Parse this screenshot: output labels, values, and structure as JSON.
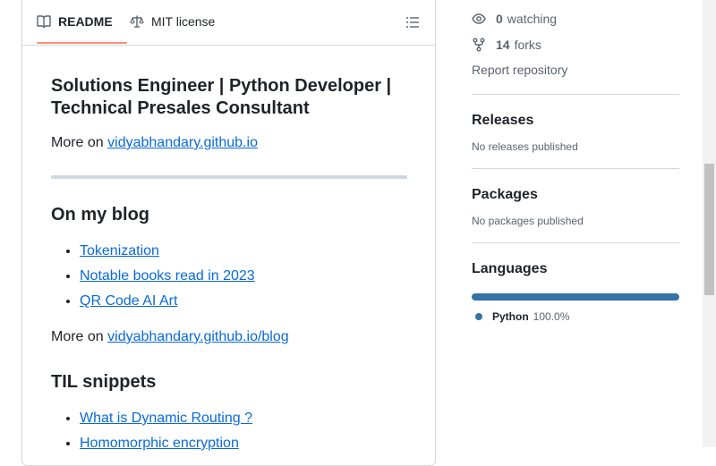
{
  "tabs": {
    "readme": "README",
    "license": "MIT license"
  },
  "readme": {
    "title": "Solutions Engineer | Python Developer | Technical Presales Consultant",
    "more_prefix": "More on ",
    "site_link": "vidyabhandary.github.io",
    "blog_heading": "On my blog",
    "blog_posts": [
      "Tokenization",
      "Notable books read in 2023",
      "QR Code AI Art"
    ],
    "blog_more_prefix": "More on ",
    "blog_link": "vidyabhandary.github.io/blog",
    "til_heading": "TIL snippets",
    "til_items": [
      "What is Dynamic Routing ?",
      "Homomorphic encryption"
    ]
  },
  "sidebar": {
    "watching_count": "0",
    "watching_label": "watching",
    "forks_count": "14",
    "forks_label": "forks",
    "report": "Report repository",
    "releases_heading": "Releases",
    "releases_sub": "No releases published",
    "packages_heading": "Packages",
    "packages_sub": "No packages published",
    "languages_heading": "Languages",
    "language_name": "Python",
    "language_pct": "100.0%",
    "language_fraction": 1.0,
    "language_color": "#3572A5"
  },
  "colors": {
    "link": "#0969da",
    "tab_underline": "#fd8c73",
    "border": "#d0d7de",
    "muted": "#59636e"
  },
  "icons": {
    "readme_tab": "book-icon",
    "license_tab": "law-scale-icon",
    "outline": "list-unordered-icon",
    "watching": "eye-icon",
    "forks": "repo-forked-icon"
  }
}
